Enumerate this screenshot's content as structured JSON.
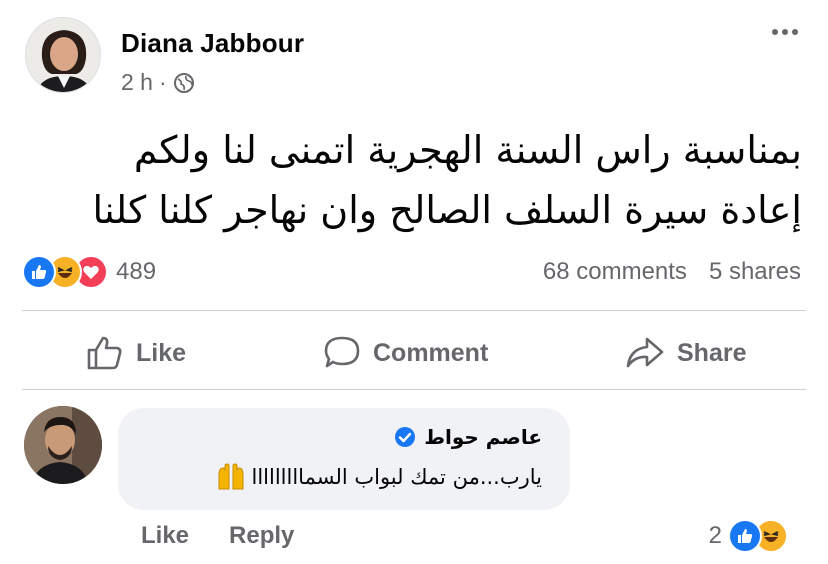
{
  "post": {
    "author": "Diana Jabbour",
    "time": "2 h",
    "separator": "·",
    "audience_icon": "globe-icon",
    "more_icon": "more-dots-icon",
    "text_line1": "بمناسبة راس السنة الهجرية اتمنى لنا ولكم",
    "text_line2": "إعادة سيرة السلف الصالح وان نهاجر كلنا كلنا"
  },
  "reactions": {
    "types": [
      "like-reaction-icon",
      "haha-reaction-icon",
      "love-reaction-icon"
    ],
    "count": "489",
    "comments": "68 comments",
    "shares": "5 shares"
  },
  "actions": {
    "like": "Like",
    "comment": "Comment",
    "share": "Share"
  },
  "comment": {
    "author": "عاصم حواط",
    "verified_icon": "verified-badge-icon",
    "text": "يارب...من تمك لبواب السمااااااااا",
    "emoji": "raised-hands-emoji",
    "like_label": "Like",
    "reply_label": "Reply",
    "reaction_count": "2"
  },
  "colors": {
    "accent_blue": "#1877f2",
    "secondary_text": "#65676b",
    "bubble_bg": "#f0f2f5",
    "haha_yellow": "#f7b125",
    "love_red": "#f33e58"
  }
}
